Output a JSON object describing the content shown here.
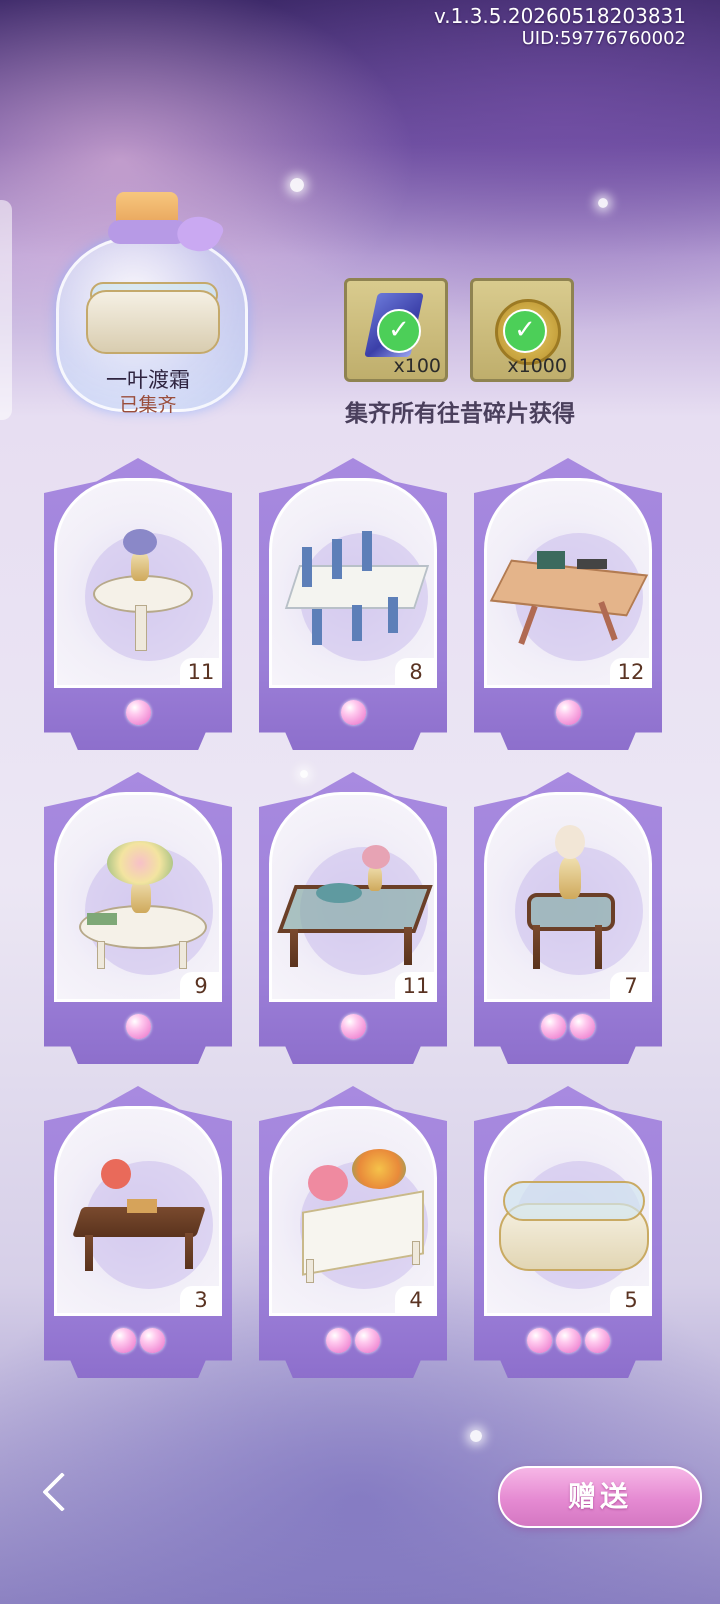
{
  "header": {
    "version": "v.1.3.5.20260518203831",
    "uid": "UID:59776760002"
  },
  "collection": {
    "name": "一叶渡霜",
    "status": "已集齐"
  },
  "rewards": {
    "items": [
      {
        "icon": "shard-checked-icon",
        "quantity": "x100"
      },
      {
        "icon": "clover-coin-checked-icon",
        "quantity": "x1000"
      }
    ],
    "caption": "集齐所有往昔碎片获得"
  },
  "cards": [
    {
      "name": "round-table-with-flowers",
      "count": "11",
      "pearls": 1
    },
    {
      "name": "dining-table-with-chairs",
      "count": "8",
      "pearls": 1
    },
    {
      "name": "wooden-tea-table",
      "count": "12",
      "pearls": 1
    },
    {
      "name": "tea-table-with-bouquet",
      "count": "9",
      "pearls": 1
    },
    {
      "name": "glass-coffee-table-tea-set",
      "count": "11",
      "pearls": 1
    },
    {
      "name": "hexagon-side-table-vase",
      "count": "7",
      "pearls": 2
    },
    {
      "name": "carved-tea-table",
      "count": "3",
      "pearls": 2
    },
    {
      "name": "white-desk-with-flowers",
      "count": "4",
      "pearls": 2
    },
    {
      "name": "jewelry-display-counter",
      "count": "5",
      "pearls": 3
    }
  ],
  "footer": {
    "give_label": "赠送"
  },
  "colors": {
    "card_frame": "#a88ae0",
    "pearl": "#e96dc8",
    "give_button": "#e58ad2"
  }
}
